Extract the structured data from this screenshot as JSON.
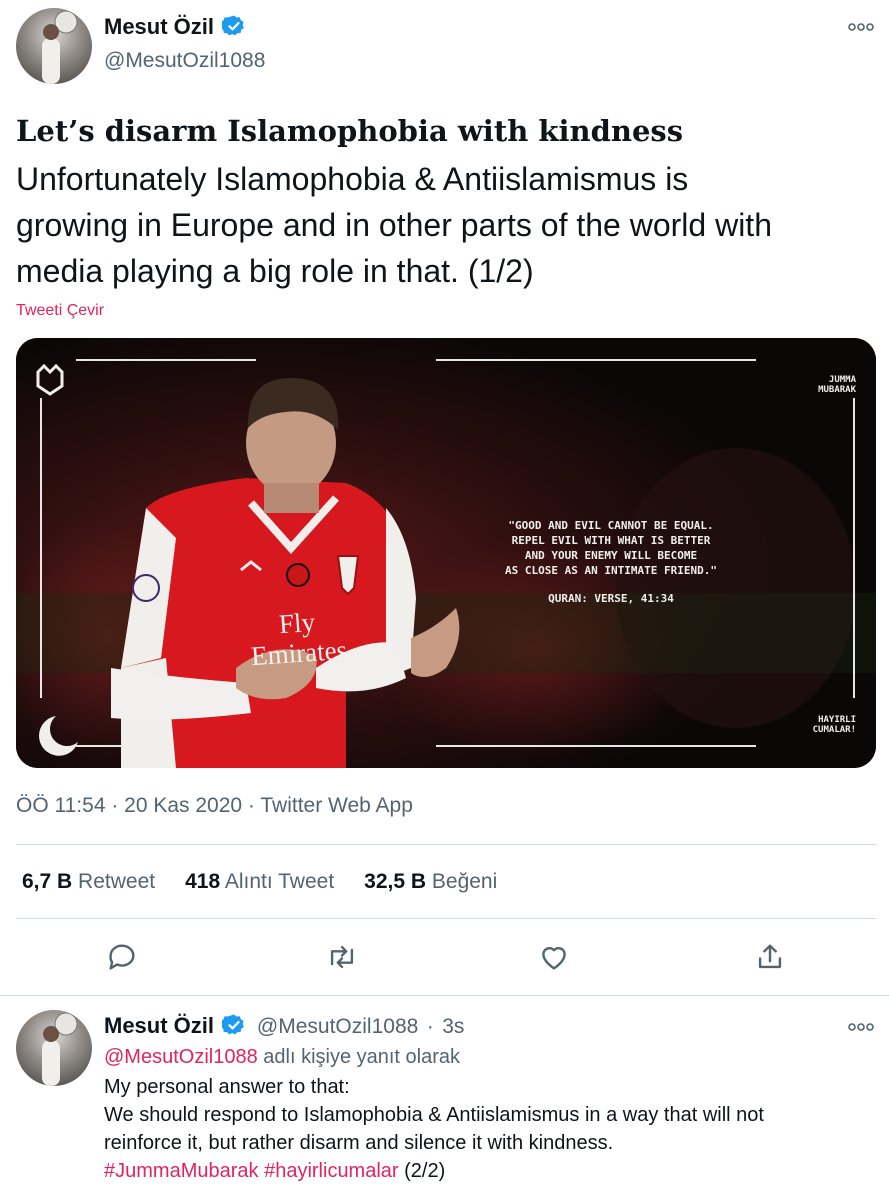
{
  "tweet": {
    "author_name": "Mesut Özil",
    "author_handle": "@MesutOzil1088",
    "headline": "Let’s disarm Islamophobia with kindness",
    "body_lines": [
      "Unfortunately Islamophobia & Antiislamismus is",
      "growing in Europe and in other parts of the world with",
      "media playing a big role in that. (1/2)"
    ],
    "translate_label": "Tweeti Çevir",
    "image": {
      "corner_top_right": [
        "JUMMA",
        "MUBARAK"
      ],
      "quote_lines": [
        "\"GOOD AND EVIL CANNOT BE EQUAL.",
        "REPEL EVIL WITH WHAT IS BETTER",
        "AND YOUR ENEMY WILL BECOME",
        "AS CLOSE AS AN INTIMATE FRIEND.\""
      ],
      "source": "QURAN: VERSE, 41:34",
      "corner_bottom_right": [
        "HAYIRLI",
        "CUMALAR!"
      ],
      "shirt_sponsor": [
        "Fly",
        "Emirates"
      ]
    },
    "timestamp": "ÖÖ 11:54 · 20 Kas 2020 · Twitter Web App",
    "stats": [
      {
        "count": "6,7 B",
        "label": "Retweet"
      },
      {
        "count": "418",
        "label": "Alıntı Tweet"
      },
      {
        "count": "32,5 B",
        "label": "Beğeni"
      }
    ],
    "actions": [
      "reply-icon",
      "retweet-icon",
      "like-icon",
      "share-icon"
    ]
  },
  "reply": {
    "author_name": "Mesut Özil",
    "author_handle": "@MesutOzil1088",
    "separator": "·",
    "time": "3s",
    "replying_to_handle": "@MesutOzil1088",
    "replying_to_suffix": " adlı kişiye yanıt olarak",
    "lines": [
      "My personal answer to that:",
      "We should respond to Islamophobia & Antiislamismus in a way that will not",
      "reinforce it, but rather disarm and silence it with kindness."
    ],
    "hashtag_1": "#JummaMubarak",
    "hashtag_2": "#hayirlicumalar",
    "suffix": " (2/2)"
  },
  "colors": {
    "accent": "#e0245e",
    "verified": "#1d9bf0",
    "muted": "#536471",
    "divider": "#cfd9de"
  }
}
